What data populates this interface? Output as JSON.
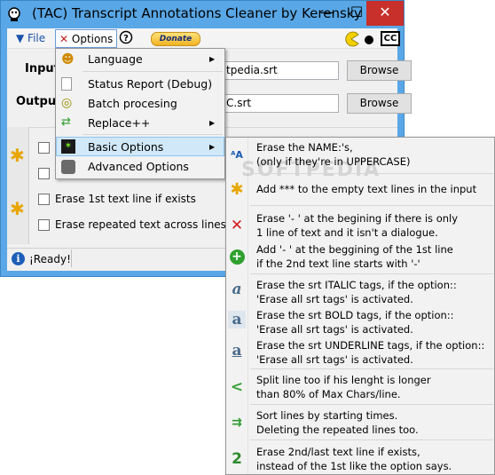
{
  "window": {
    "title": "(TAC) Transcript Annotations Cleaner  by  Kerensky",
    "minimize": "—",
    "maximize": "☐",
    "close": "✕"
  },
  "menubar": {
    "file": "▼ File",
    "options": "Options",
    "donate": "Donate"
  },
  "form": {
    "input_label": "Input",
    "output_label": "Output",
    "input_value": "tpedia.srt",
    "output_value": "C.srt",
    "browse_in": "Browse",
    "browse_out": "Browse"
  },
  "checkboxes": {
    "erase_first_line": "Erase 1st text line if exists",
    "erase_repeated": "Erase repeated text across lines."
  },
  "status": {
    "text": "¡Ready!"
  },
  "options_menu": {
    "items": [
      {
        "label": "Language",
        "has_submenu": true
      },
      {
        "label": "Status Report (Debug)",
        "has_submenu": false
      },
      {
        "label": "Batch procesing",
        "has_submenu": false
      },
      {
        "label": "Replace++",
        "has_submenu": true
      },
      {
        "label": "Basic Options",
        "has_submenu": true
      },
      {
        "label": "Advanced Options",
        "has_submenu": false
      }
    ]
  },
  "basic_options": [
    {
      "icon": "font-icon",
      "lines": [
        "Erase the NAME:'s,",
        "(only if they're in UPPERCASE)"
      ]
    },
    {
      "icon": "star-icon",
      "lines": [
        "Add *** to the empty text lines in the input"
      ]
    },
    {
      "icon": "red-x-icon",
      "lines": [
        "Erase '- ' at the begining if there is only",
        " 1 line of text and it isn't a dialogue."
      ]
    },
    {
      "icon": "green-plus-icon",
      "lines": [
        "Add '- ' at the beggining of the 1st line",
        "if the 2nd text line starts with '-'"
      ]
    },
    {
      "icon": "italic-a-icon",
      "lines": [
        "Erase the srt ITALIC tags, if the option::",
        "'Erase all srt tags' is activated."
      ]
    },
    {
      "icon": "bold-a-icon",
      "lines": [
        "Erase the srt BOLD tags, if the option::",
        "'Erase all srt tags' is activated."
      ]
    },
    {
      "icon": "underline-a-icon",
      "lines": [
        "Erase the srt UNDERLINE tags, if the option::",
        "'Erase all srt tags' is activated."
      ]
    },
    {
      "icon": "split-arrow-icon",
      "lines": [
        "Split line too if his lenght is longer",
        "than 80% of Max Chars/line."
      ]
    },
    {
      "icon": "sort-arrows-icon",
      "lines": [
        "Sort lines by starting times.",
        "Deleting the repeated lines too."
      ]
    },
    {
      "icon": "number-two-icon",
      "lines": [
        "Erase 2nd/last text line if exists,",
        "instead of the 1st like the option says."
      ]
    }
  ]
}
